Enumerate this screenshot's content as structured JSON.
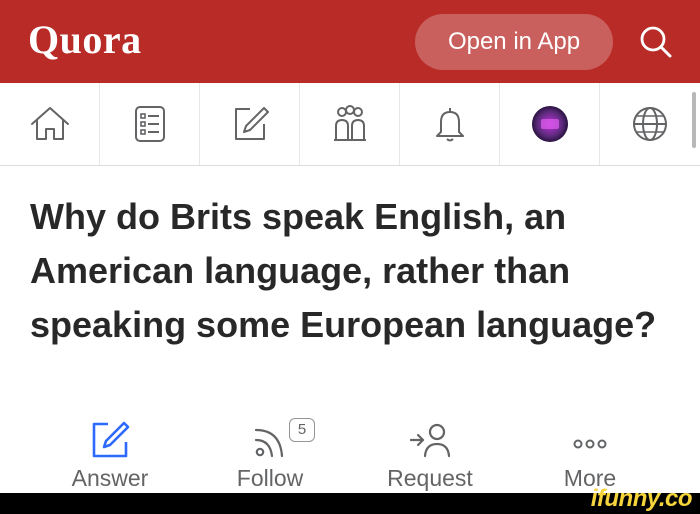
{
  "header": {
    "logo": "Quora",
    "open_app_label": "Open in App",
    "search_icon": "search-icon",
    "brand_color": "#b92b27"
  },
  "nav": {
    "items": [
      {
        "name": "home",
        "icon": "home-icon"
      },
      {
        "name": "following",
        "icon": "feed-list-icon"
      },
      {
        "name": "answer",
        "icon": "pencil-square-icon"
      },
      {
        "name": "spaces",
        "icon": "people-group-icon"
      },
      {
        "name": "notifications",
        "icon": "bell-icon"
      },
      {
        "name": "profile",
        "icon": "avatar-icon"
      },
      {
        "name": "language",
        "icon": "globe-icon"
      }
    ]
  },
  "question": {
    "text": "Why do Brits speak English, an American language, rather than speaking some European language?"
  },
  "actions": {
    "answer_label": "Answer",
    "follow_label": "Follow",
    "follow_count": "5",
    "request_label": "Request",
    "more_label": "More",
    "answer_icon_color": "#2e69ff"
  },
  "watermark": {
    "text": "ifunny.co",
    "color": "#f6d43b"
  }
}
